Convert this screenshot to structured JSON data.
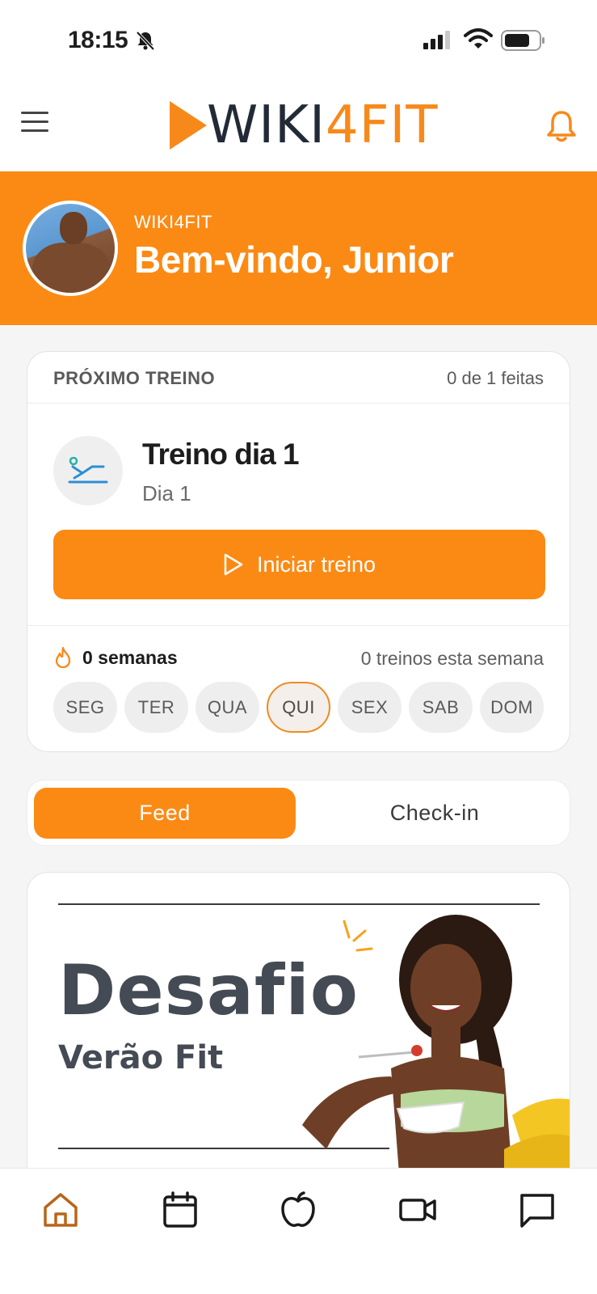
{
  "status_bar": {
    "time": "18:15",
    "icons": [
      "bell-slash-icon",
      "cellular-signal-icon",
      "wifi-icon",
      "battery-icon"
    ]
  },
  "header": {
    "logo_text_dark": "WIKI",
    "logo_text_orange": "4FIT",
    "icons": [
      "hamburger-menu-icon",
      "notification-bell-icon"
    ]
  },
  "hero": {
    "brand": "WIKI4FIT",
    "welcome": "Bem-vindo, Junior"
  },
  "next_workout": {
    "label": "PRÓXIMO TREINO",
    "completed": "0 de 1 feitas",
    "title": "Treino dia 1",
    "subtitle": "Dia 1",
    "start_button": "Iniciar treino",
    "streak": "0 semanas",
    "week_count": "0 treinos esta semana",
    "days": [
      "SEG",
      "TER",
      "QUA",
      "QUI",
      "SEX",
      "SAB",
      "DOM"
    ],
    "active_day": "QUI"
  },
  "tabs": {
    "feed": "Feed",
    "checkin": "Check-in",
    "selected": "Feed"
  },
  "promo": {
    "title": "Desafio",
    "subtitle": "Verão Fit"
  },
  "bottom_nav": {
    "items": [
      "home-icon",
      "calendar-icon",
      "apple-icon",
      "video-icon",
      "chat-icon"
    ],
    "active": "home-icon"
  },
  "colors": {
    "accent": "#fb8a14",
    "dark": "#232a37",
    "background": "#f6f5f5"
  }
}
